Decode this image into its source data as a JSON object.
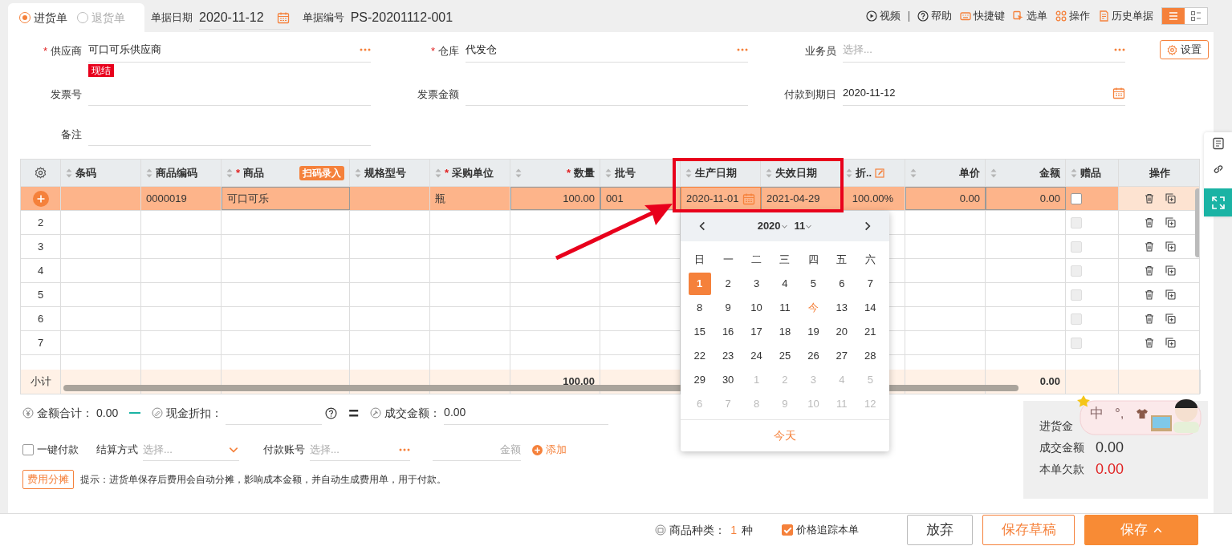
{
  "tabs": [
    {
      "label": "进货单",
      "selected": true
    },
    {
      "label": "退货单",
      "selected": false
    }
  ],
  "doc_date": {
    "label": "单据日期",
    "value": "2020-11-12"
  },
  "doc_no": {
    "label": "单据编号",
    "value": "PS-20201112-001"
  },
  "toolbar": [
    {
      "label": "视频"
    },
    {
      "label": "帮助"
    },
    {
      "label": "快捷键"
    },
    {
      "label": "选单"
    },
    {
      "label": "操作"
    },
    {
      "label": "历史单据"
    }
  ],
  "view_toggle": [
    {
      "selected": true
    },
    {
      "selected": false
    }
  ],
  "settings_button": "设置",
  "form_rows": [
    [
      {
        "label": "供应商",
        "asterisk": "*",
        "value": "可口可乐供应商",
        "kind": "select",
        "tag": "现结"
      },
      {
        "label": "仓库",
        "asterisk": "*",
        "value": "代发仓",
        "kind": "select"
      },
      {
        "label": "业务员",
        "placeholder": "选择...",
        "kind": "select"
      }
    ],
    [
      {
        "label": "发票号",
        "kind": "text"
      },
      {
        "label": "发票金额",
        "kind": "text"
      },
      {
        "label": "付款到期日",
        "value": "2020-11-12",
        "kind": "date"
      }
    ],
    [
      {
        "label": "备注",
        "kind": "text"
      }
    ]
  ],
  "columns": [
    {
      "title": "条码",
      "sortable": true,
      "editable": false
    },
    {
      "title": "商品编码",
      "sortable": true,
      "editable": false
    },
    {
      "title": "商品",
      "sortable": true,
      "asterisk": "*",
      "badge": "扫码录入",
      "editable": true
    },
    {
      "title": "规格型号",
      "sortable": true,
      "editable": false
    },
    {
      "title": "采购单位",
      "sortable": true,
      "asterisk": "*",
      "editable": false
    },
    {
      "title": "数量",
      "sortable": true,
      "asterisk": "*",
      "editable": true
    },
    {
      "title": "批号",
      "sortable": true,
      "editable": true
    },
    {
      "title": "生产日期",
      "sortable": true,
      "editable": true
    },
    {
      "title": "失效日期",
      "sortable": true,
      "editable": true
    },
    {
      "title": "折..",
      "sortable": true,
      "edit_icon": true,
      "editable": false
    },
    {
      "title": "单价",
      "sortable": true,
      "editable": true
    },
    {
      "title": "金额",
      "sortable": true,
      "editable": true
    }
  ],
  "gift_column": {
    "title": "赠品",
    "sortable": true
  },
  "ops_column": {
    "title": "操作"
  },
  "rows": [
    {
      "selected": true,
      "cells": [
        null,
        "0000019",
        "可口可乐",
        null,
        "瓶",
        "100.00",
        "001",
        {
          "text": "2020-11-01",
          "focused": true
        },
        "2021-04-29",
        "100.00%",
        "0.00",
        "0.00"
      ],
      "gift": {
        "checked": false,
        "disabled": false
      }
    },
    {
      "selected": false,
      "number": "2",
      "gift": {
        "checked": false,
        "disabled": true
      }
    },
    {
      "selected": false,
      "number": "3",
      "gift": {
        "checked": false,
        "disabled": true
      }
    },
    {
      "selected": false,
      "number": "4",
      "gift": {
        "checked": false,
        "disabled": true
      }
    },
    {
      "selected": false,
      "number": "5",
      "gift": {
        "checked": false,
        "disabled": true
      }
    },
    {
      "selected": false,
      "number": "6",
      "gift": {
        "checked": false,
        "disabled": true
      }
    },
    {
      "selected": false,
      "number": "7",
      "gift": {
        "checked": false,
        "disabled": true
      }
    }
  ],
  "totals": {
    "label": "小计",
    "cells": [
      null,
      null,
      null,
      null,
      null,
      "100.00",
      null,
      null,
      null,
      null,
      null,
      "0.00"
    ]
  },
  "calendar": {
    "year": "2020",
    "month": "11",
    "weekdays": [
      "日",
      "一",
      "二",
      "三",
      "四",
      "五",
      "六"
    ],
    "days": [
      {
        "label": "1",
        "selected": true,
        "today": false,
        "other_month": false
      },
      {
        "label": "2",
        "selected": false,
        "today": false,
        "other_month": false
      },
      {
        "label": "3",
        "selected": false,
        "today": false,
        "other_month": false
      },
      {
        "label": "4",
        "selected": false,
        "today": false,
        "other_month": false
      },
      {
        "label": "5",
        "selected": false,
        "today": false,
        "other_month": false
      },
      {
        "label": "6",
        "selected": false,
        "today": false,
        "other_month": false
      },
      {
        "label": "7",
        "selected": false,
        "today": false,
        "other_month": false
      },
      {
        "label": "8",
        "selected": false,
        "today": false,
        "other_month": false
      },
      {
        "label": "9",
        "selected": false,
        "today": false,
        "other_month": false
      },
      {
        "label": "10",
        "selected": false,
        "today": false,
        "other_month": false
      },
      {
        "label": "11",
        "selected": false,
        "today": false,
        "other_month": false
      },
      {
        "label": "今",
        "selected": false,
        "today": true,
        "other_month": false
      },
      {
        "label": "13",
        "selected": false,
        "today": false,
        "other_month": false
      },
      {
        "label": "14",
        "selected": false,
        "today": false,
        "other_month": false
      },
      {
        "label": "15",
        "selected": false,
        "today": false,
        "other_month": false
      },
      {
        "label": "16",
        "selected": false,
        "today": false,
        "other_month": false
      },
      {
        "label": "17",
        "selected": false,
        "today": false,
        "other_month": false
      },
      {
        "label": "18",
        "selected": false,
        "today": false,
        "other_month": false
      },
      {
        "label": "19",
        "selected": false,
        "today": false,
        "other_month": false
      },
      {
        "label": "20",
        "selected": false,
        "today": false,
        "other_month": false
      },
      {
        "label": "21",
        "selected": false,
        "today": false,
        "other_month": false
      },
      {
        "label": "22",
        "selected": false,
        "today": false,
        "other_month": false
      },
      {
        "label": "23",
        "selected": false,
        "today": false,
        "other_month": false
      },
      {
        "label": "24",
        "selected": false,
        "today": false,
        "other_month": false
      },
      {
        "label": "25",
        "selected": false,
        "today": false,
        "other_month": false
      },
      {
        "label": "26",
        "selected": false,
        "today": false,
        "other_month": false
      },
      {
        "label": "27",
        "selected": false,
        "today": false,
        "other_month": false
      },
      {
        "label": "28",
        "selected": false,
        "today": false,
        "other_month": false
      },
      {
        "label": "29",
        "selected": false,
        "today": false,
        "other_month": false
      },
      {
        "label": "30",
        "selected": false,
        "today": false,
        "other_month": false
      },
      {
        "label": "1",
        "selected": false,
        "today": false,
        "other_month": true
      },
      {
        "label": "2",
        "selected": false,
        "today": false,
        "other_month": true
      },
      {
        "label": "3",
        "selected": false,
        "today": false,
        "other_month": true
      },
      {
        "label": "4",
        "selected": false,
        "today": false,
        "other_month": true
      },
      {
        "label": "5",
        "selected": false,
        "today": false,
        "other_month": true
      },
      {
        "label": "6",
        "selected": false,
        "today": false,
        "other_month": true
      },
      {
        "label": "7",
        "selected": false,
        "today": false,
        "other_month": true
      },
      {
        "label": "8",
        "selected": false,
        "today": false,
        "other_month": true
      },
      {
        "label": "9",
        "selected": false,
        "today": false,
        "other_month": true
      },
      {
        "label": "10",
        "selected": false,
        "today": false,
        "other_month": true
      },
      {
        "label": "11",
        "selected": false,
        "today": false,
        "other_month": true
      },
      {
        "label": "12",
        "selected": false,
        "today": false,
        "other_month": true
      }
    ],
    "today_button": "今天"
  },
  "summary": {
    "total_label": "金额合计：",
    "total": "0.00",
    "discount_label": "现金折扣：",
    "equals": "=",
    "deal_label": "成交金额：",
    "deal": "0.00"
  },
  "payment": {
    "one_click": {
      "label": "一键付款",
      "checked": false
    },
    "method_label": "结算方式",
    "method_placeholder": "选择...",
    "account_label": "付款账号",
    "account_placeholder": "选择...",
    "amount_placeholder": "金额",
    "add": "添加"
  },
  "cost_button": "费用分摊",
  "hint": "提示：进货单保存后费用会自动分摊，影响成本金额，并自动生成费用单，用于付款。",
  "totals_box": [
    {
      "label": "进货金"
    },
    {
      "label": "成交金额",
      "value": "0.00"
    },
    {
      "label": "本单欠款",
      "value": "0.00",
      "kind": "due"
    }
  ],
  "ime_toolbar": {
    "mode": "中",
    "punctuation": "°,"
  },
  "footer": {
    "kinds_label": "商品种类：",
    "kinds_count": "1",
    "kinds_unit": "种",
    "track": {
      "label": "价格追踪本单",
      "checked": true
    },
    "buttons": [
      {
        "label": "放弃",
        "kind": "default"
      },
      {
        "label": "保存草稿",
        "kind": "outline"
      },
      {
        "label": "保存",
        "kind": "primary",
        "caret": true
      }
    ]
  }
}
